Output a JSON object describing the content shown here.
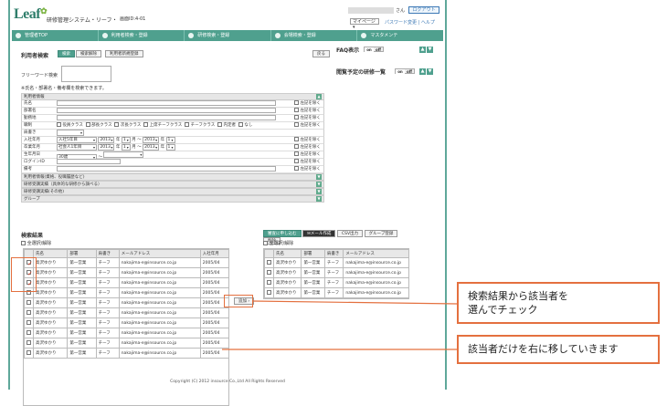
{
  "header": {
    "logo": "Leaf",
    "system_title": "研修管理システム・リーフ・",
    "screen_id": "画面ID:4-01",
    "user_suffix": "さん",
    "logout": "ログアウト",
    "mypage": "マイページ",
    "password_change": "パスワード変更",
    "help": "ヘルプ"
  },
  "nav": {
    "tabs": [
      {
        "label": "管理者TOP"
      },
      {
        "label": "利用者検索・登録"
      },
      {
        "label": "研修検索・登録"
      },
      {
        "label": "会場検索・登録"
      },
      {
        "label": "マスタメンテ"
      }
    ]
  },
  "search": {
    "title": "利用者検索",
    "search_btn": "検索",
    "clear_btn": "検索解除",
    "bulk_btn": "利用者新規登録",
    "back_btn": "戻る",
    "freeword_label": "フリーワード検索",
    "note": "※氏名・部署名・備考欄を検索できます。",
    "info_header": "利用者情報",
    "clear_label": "左記を除く",
    "fields": [
      {
        "label": "氏名"
      },
      {
        "label": "部署名"
      },
      {
        "label": "勤務地"
      },
      {
        "label": "職制"
      },
      {
        "label": "肩書き"
      },
      {
        "label": "入社年月"
      },
      {
        "label": "卒業年月"
      },
      {
        "label": "生年月日"
      },
      {
        "label": "ログインID"
      },
      {
        "label": "備考"
      }
    ],
    "roles": [
      "役員クラス",
      "部長クラス",
      "次長クラス",
      "上席チーフクラス",
      "チーフクラス",
      "内定者",
      "なし"
    ],
    "join_type": "入社5年目",
    "grad_type": "社会人1年目",
    "birth_val": "30歳",
    "year_val": "2013",
    "month_val": "1",
    "year_unit": "年",
    "month_tilde": "月 ～",
    "month_unit": "月",
    "tilde": "～",
    "sections": [
      "利用者情報(資格、役職履歴など)",
      "研修受講実績（具体的な研修から調べる）",
      "研修受講実績(その他)",
      "グループ"
    ]
  },
  "side": {
    "faq_label": "FAQ表示",
    "plan_label": "閲覧予定の研修一覧",
    "on": "on",
    "off": "off",
    "up": "▲",
    "down": "▼"
  },
  "results": {
    "title": "検索結果",
    "select_all": "全選択/解除",
    "columns": [
      "氏名",
      "部署",
      "肩書き",
      "メールアドレス",
      "入社年月"
    ],
    "rows": [
      {
        "name": "高沢ゆかり",
        "dept": "第一営業",
        "title": "チーフ",
        "email": "nakajima-e@insource.co.jp",
        "join": "2005/04",
        "checked": true
      },
      {
        "name": "高沢ゆかり",
        "dept": "第一営業",
        "title": "チーフ",
        "email": "nakajima-e@insource.co.jp",
        "join": "2005/04",
        "checked": true
      },
      {
        "name": "高沢ゆかり",
        "dept": "第一営業",
        "title": "チーフ",
        "email": "nakajima-e@insource.co.jp",
        "join": "2005/04",
        "checked": true
      },
      {
        "name": "高沢ゆかり",
        "dept": "第一営業",
        "title": "チーフ",
        "email": "nakajima-e@insource.co.jp",
        "join": "2005/04",
        "checked": false
      },
      {
        "name": "高沢ゆかり",
        "dept": "第一営業",
        "title": "チーフ",
        "email": "nakajima-e@insource.co.jp",
        "join": "2005/04",
        "checked": false
      },
      {
        "name": "高沢ゆかり",
        "dept": "第一営業",
        "title": "チーフ",
        "email": "nakajima-e@insource.co.jp",
        "join": "2005/04",
        "checked": false
      },
      {
        "name": "高沢ゆかり",
        "dept": "第一営業",
        "title": "チーフ",
        "email": "nakajima-e@insource.co.jp",
        "join": "2005/04",
        "checked": false
      },
      {
        "name": "高沢ゆかり",
        "dept": "第一営業",
        "title": "チーフ",
        "email": "nakajima-e@insource.co.jp",
        "join": "2005/04",
        "checked": false
      },
      {
        "name": "高沢ゆかり",
        "dept": "第一営業",
        "title": "チーフ",
        "email": "nakajima-e@insource.co.jp",
        "join": "2005/04",
        "checked": false
      },
      {
        "name": "高沢ゆかり",
        "dept": "第一営業",
        "title": "チーフ",
        "email": "nakajima-e@insource.co.jp",
        "join": "2005/04",
        "checked": false
      }
    ],
    "add_btn": "追加 ›"
  },
  "selected": {
    "buttons": [
      "審査に申し込む",
      "メール作成",
      "CSV出力",
      "グループ登録",
      "削除"
    ],
    "select_all": "全選択/解除",
    "columns": [
      "氏名",
      "部署",
      "肩書き",
      "メールアドレス"
    ],
    "rows": [
      {
        "name": "高沢ゆかり",
        "dept": "第一営業",
        "title": "チーフ",
        "email": "nakajima-e@insource.co.jp"
      },
      {
        "name": "高沢ゆかり",
        "dept": "第一営業",
        "title": "チーフ",
        "email": "nakajima-e@insource.co.jp"
      },
      {
        "name": "高沢ゆかり",
        "dept": "第一営業",
        "title": "チーフ",
        "email": "nakajima-e@insource.co.jp"
      },
      {
        "name": "高沢ゆかり",
        "dept": "第一営業",
        "title": "チーフ",
        "email": "nakajima-e@insource.co.jp"
      }
    ]
  },
  "callouts": {
    "first": "検索結果から該当者を\n選んでチェック",
    "second": "該当者だけを右に移していきます"
  },
  "footer": "Copyright (C) 2012 insource Co.,Ltd All Rights Reserved",
  "colors": {
    "accent": "#4fa08e",
    "callout": "#e4703f",
    "link": "#3b78b5"
  }
}
